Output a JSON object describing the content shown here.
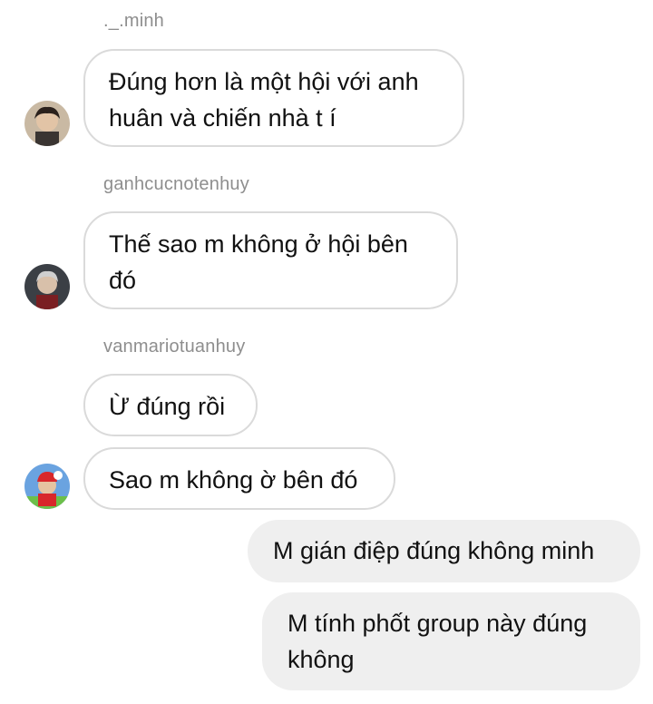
{
  "messages": [
    {
      "sender": "._.minh",
      "bubbles": [
        "Đúng hơn là một hội với anh huân và chiến nhà t í"
      ],
      "avatar_icon": "profile-photo-icon"
    },
    {
      "sender": "ganhcucnotenhuy",
      "bubbles": [
        "Thế sao m không ở hội bên đó"
      ],
      "avatar_icon": "profile-photo-icon"
    },
    {
      "sender": "vanmariotuanhuy",
      "bubbles": [
        "Ừ đúng rồi",
        "Sao m không ờ bên đó"
      ],
      "avatar_icon": "mario-avatar-icon"
    }
  ],
  "outgoing": [
    "M gián điệp đúng không minh",
    "M tính phốt group này đúng không"
  ],
  "colors": {
    "incoming_border": "#dadada",
    "outgoing_bg": "#efefef",
    "sender_text": "#8e8e8e"
  }
}
